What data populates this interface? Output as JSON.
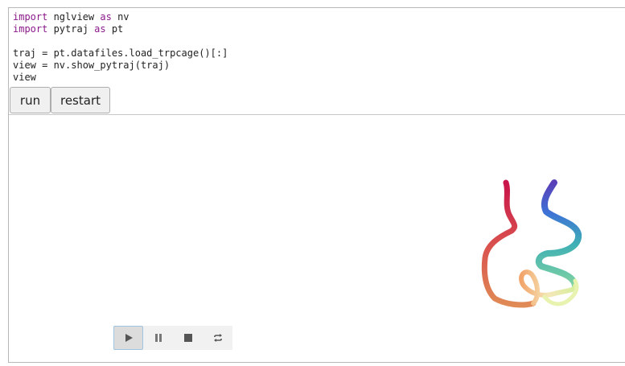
{
  "code": {
    "line1": [
      "import",
      " nglview ",
      "as",
      " nv"
    ],
    "line2": [
      "import",
      " pytraj ",
      "as",
      " pt"
    ],
    "line3": "traj = pt.datafiles.load_trpcage()[:]",
    "line4": "view = nv.show_pytraj(traj)",
    "line5": "view"
  },
  "buttons": {
    "run_label": "run",
    "restart_label": "restart"
  },
  "player": {
    "controls": [
      "play-icon",
      "pause-icon",
      "stop-icon",
      "repeat-icon"
    ],
    "active": "play"
  },
  "colors": {
    "keyword": "#8b1a8b",
    "active_border": "#9fc3e0"
  }
}
